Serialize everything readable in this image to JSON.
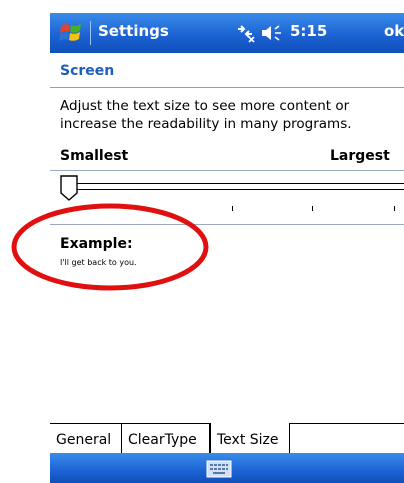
{
  "titlebar": {
    "app_title": "Settings",
    "clock": "5:15",
    "ok_label": "ok",
    "start_icon": "windows-flag-icon",
    "connectivity_icon": "connectivity-icon",
    "volume_icon": "volume-icon"
  },
  "subheader": {
    "title": "Screen"
  },
  "content": {
    "description": "Adjust the text size to see more content or increase the readability in many programs.",
    "slider": {
      "min_label": "Smallest",
      "max_label": "Largest",
      "value_fraction": 0.0
    },
    "example_label": "Example:",
    "example_text": "I'll get back to you."
  },
  "tabs": [
    {
      "label": "General"
    },
    {
      "label": "ClearType"
    },
    {
      "label": "Text Size",
      "selected": true
    }
  ],
  "menubar": {
    "keyboard_icon": "keyboard-icon"
  },
  "colors": {
    "titlebar_blue": "#1c63d3",
    "header_text": "#1d5fba",
    "annotation_red": "#e01010"
  }
}
